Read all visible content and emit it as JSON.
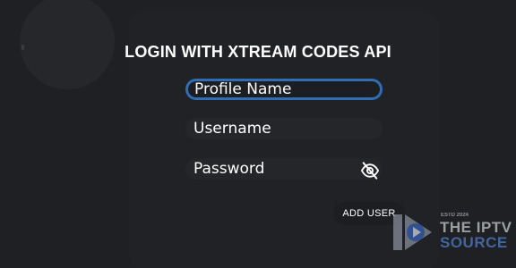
{
  "form": {
    "title": "LOGIN WITH XTREAM CODES API",
    "fields": [
      {
        "label": "Profile Name",
        "focused": true
      },
      {
        "label": "Username",
        "focused": false
      },
      {
        "label": "Password",
        "focused": false
      }
    ],
    "password_toggle_icon": "eye-slash-icon",
    "add_user_label": "ADD USER"
  },
  "watermark": {
    "established": "ESTD 2024",
    "line1": "THE IPTV",
    "line2": "SOURCE",
    "logo_icon": "play-icon"
  },
  "colors": {
    "background": "#1e2023",
    "panel": "#202225",
    "focus_border": "#2f6db5",
    "watermark_accent": "#5a8fe8"
  }
}
